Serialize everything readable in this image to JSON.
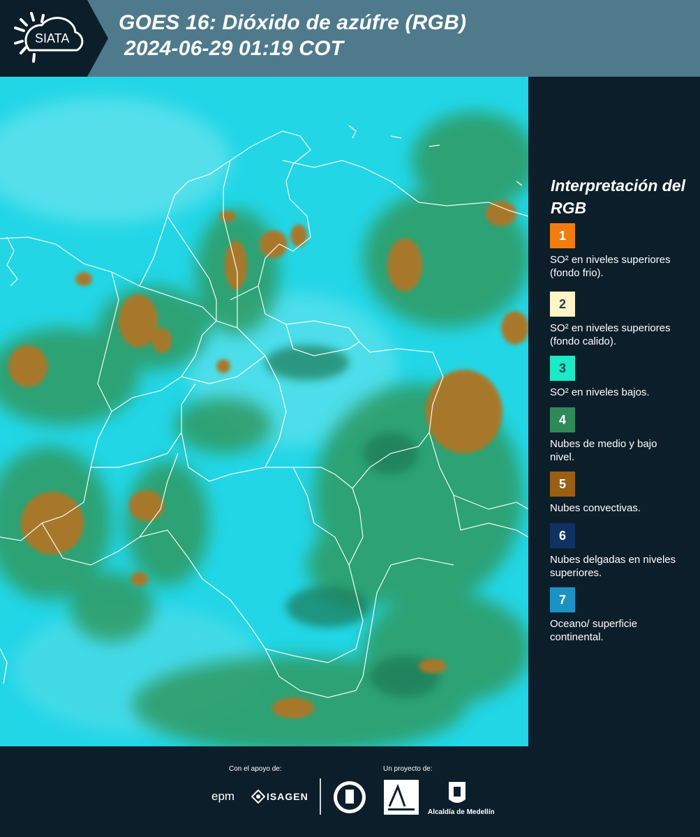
{
  "header": {
    "logo_text": "SIATA",
    "title_line1": "GOES 16: Dióxido de azúfre (RGB)",
    "title_line2": "2024-06-29 01:19 COT"
  },
  "legend": {
    "title": "Interpretación del RGB",
    "items": [
      {
        "number": "1",
        "color": "#f07d0e",
        "text_color": "#ffffff",
        "text": "SO² en niveles superiores (fondo frio)."
      },
      {
        "number": "2",
        "color": "#fdf5c6",
        "text_color": "#2c3e50",
        "text": "SO² en niveles superiores (fondo calido)."
      },
      {
        "number": "3",
        "color": "#1de9c4",
        "text_color": "#1b4a5a",
        "text": "SO² en niveles bajos."
      },
      {
        "number": "4",
        "color": "#2e8a58",
        "text_color": "#ffffff",
        "text": "Nubes de medio y bajo nivel."
      },
      {
        "number": "5",
        "color": "#9a5f12",
        "text_color": "#ffffff",
        "text": "Nubes convectivas."
      },
      {
        "number": "6",
        "color": "#0f3263",
        "text_color": "#ffffff",
        "text": "Nubes delgadas en niveles superiores."
      },
      {
        "number": "7",
        "color": "#1a93c4",
        "text_color": "#ffffff",
        "text": "Oceano/ superficie continental."
      }
    ]
  },
  "footer": {
    "support_label": "Con el apoyo de:",
    "project_label": "Un proyecto de:",
    "sponsor1": "epm",
    "sponsor2": "ISAGEN",
    "partner1": "Área Metropolitana Valle de Aburrá",
    "partner2": "Alcaldía de Medellín"
  },
  "colors": {
    "header_bg": "#4f7a8c",
    "logo_bg": "#0d1e2b",
    "ocean": "#22d6e6",
    "mid_low_clouds": "#2e8a58",
    "convective": "#a8782a",
    "borders": "#ffffff"
  }
}
